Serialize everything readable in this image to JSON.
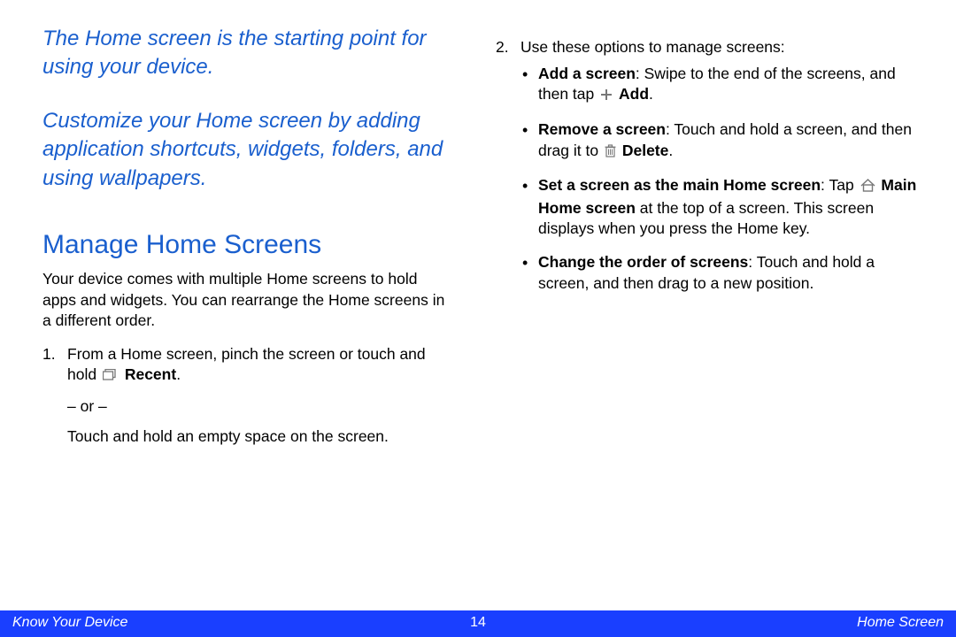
{
  "intro": {
    "p1": "The Home screen is the starting point for using your device.",
    "p2": "Customize your Home screen by adding application shortcuts, widgets, folders, and using wallpapers."
  },
  "heading": "Manage Home Screens",
  "body_intro": "Your device comes with multiple Home screens to hold apps and widgets. You can rearrange the Home screens in a different order.",
  "step1": {
    "num": "1.",
    "part1": "From a Home screen, pinch the screen or touch and hold ",
    "recent_label": "Recent",
    "period": ".",
    "or": "– or –",
    "part2": "Touch and hold an empty space on the screen."
  },
  "step2": {
    "num": "2.",
    "lead": "Use these options to manage screens:",
    "add": {
      "bold": "Add a screen",
      "t1": ": Swipe to the end of the screens, and then tap ",
      "add_label": "Add",
      "period": "."
    },
    "remove": {
      "bold": "Remove a screen",
      "t1": ": Touch and hold a screen, and then drag it to ",
      "delete_label": "Delete",
      "period": "."
    },
    "main": {
      "bold": "Set a screen as the main Home screen",
      "t1": ": Tap ",
      "main_label": "Main Home screen",
      "t2": " at the top of a screen. This screen displays when you press the Home key."
    },
    "order": {
      "bold": "Change the order of screens",
      "t1": ": Touch and hold a screen, and then drag to a new position."
    }
  },
  "footer": {
    "left": "Know Your Device",
    "center": "14",
    "right": "Home Screen"
  }
}
